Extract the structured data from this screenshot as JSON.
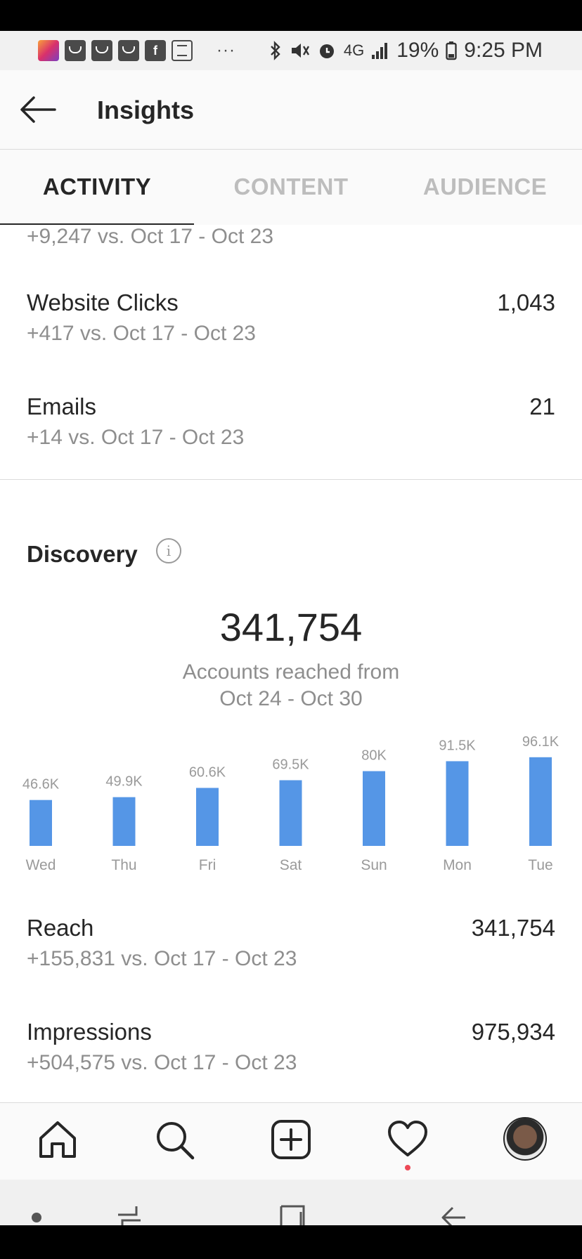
{
  "status_bar": {
    "dots": "···",
    "network": "4G",
    "battery": "19%",
    "time": "9:25 PM"
  },
  "header": {
    "title": "Insights"
  },
  "tabs": [
    {
      "label": "ACTIVITY",
      "active": true
    },
    {
      "label": "CONTENT",
      "active": false
    },
    {
      "label": "AUDIENCE",
      "active": false
    }
  ],
  "interactions": {
    "partial_row_sub": "+9,247 vs. Oct 17 - Oct 23",
    "rows": [
      {
        "label": "Website Clicks",
        "value": "1,043",
        "sub": "+417 vs. Oct 17 - Oct 23"
      },
      {
        "label": "Emails",
        "value": "21",
        "sub": "+14 vs. Oct 17 - Oct 23"
      }
    ]
  },
  "discovery": {
    "title": "Discovery",
    "info_glyph": "i",
    "total": "341,754",
    "caption_line1": "Accounts reached from",
    "caption_line2": "Oct 24 - Oct 30",
    "rows": [
      {
        "label": "Reach",
        "value": "341,754",
        "sub": "+155,831 vs. Oct 17 - Oct 23"
      },
      {
        "label": "Impressions",
        "value": "975,934",
        "sub": "+504,575 vs. Oct 17 - Oct 23"
      }
    ]
  },
  "chart_data": {
    "type": "bar",
    "categories": [
      "Wed",
      "Thu",
      "Fri",
      "Sat",
      "Sun",
      "Mon",
      "Tue"
    ],
    "values": [
      46.6,
      49.9,
      60.6,
      69.5,
      80,
      91.5,
      96.1
    ],
    "value_labels": [
      "46.6K",
      "49.9K",
      "60.6K",
      "69.5K",
      "80K",
      "91.5K",
      "96.1K"
    ],
    "unit": "K",
    "bar_color": "#5596e6",
    "title": "",
    "xlabel": "",
    "ylabel": "",
    "ylim": [
      0,
      100
    ],
    "grid": false
  },
  "bottom_nav": [
    "home-icon",
    "search-icon",
    "new-post-icon",
    "activity-heart-icon",
    "profile-avatar"
  ],
  "colors": {
    "accent_blue": "#5596e6",
    "secondary_text": "#8e8e8e",
    "notification_dot": "#ed4956"
  }
}
